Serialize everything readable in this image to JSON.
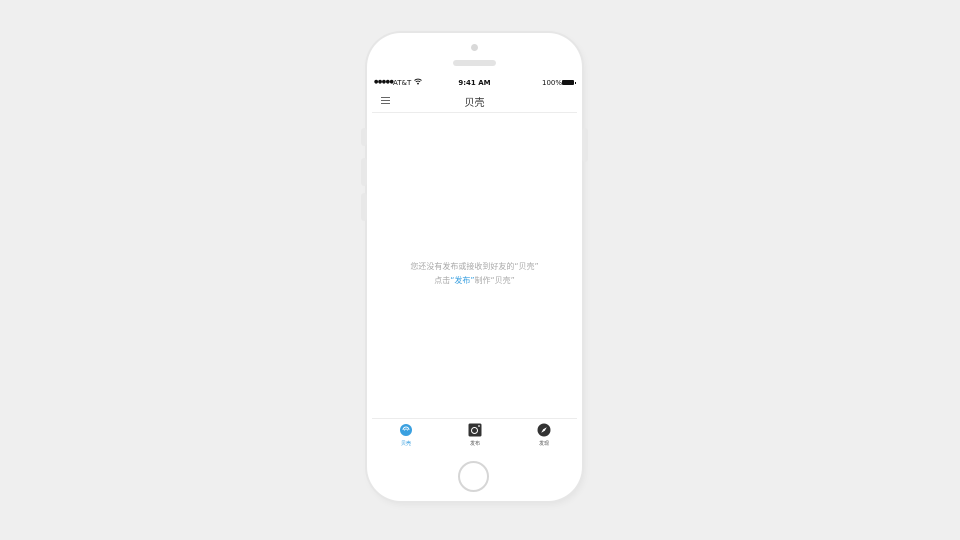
{
  "statusbar": {
    "signal": "●●●●●",
    "carrier": "AT&T",
    "wifi_icon": "wifi-icon",
    "time": "9:41 AM",
    "battery": "100%"
  },
  "navbar": {
    "title": "贝壳",
    "menu_icon": "hamburger-menu-icon"
  },
  "empty_state": {
    "line1": "您还没有发布或接收到好友的“贝壳”",
    "line2_prefix": "点击",
    "line2_link": "“发布”",
    "line2_suffix": "制作“贝壳”"
  },
  "tabbar": {
    "items": [
      {
        "label": "贝壳",
        "icon": "shell-icon",
        "active": true
      },
      {
        "label": "发布",
        "icon": "camera-icon",
        "active": false
      },
      {
        "label": "发现",
        "icon": "compass-icon",
        "active": false
      }
    ]
  },
  "colors": {
    "accent": "#3aa0e0",
    "background": "#efefef",
    "muted_text": "#a8a8a8"
  }
}
